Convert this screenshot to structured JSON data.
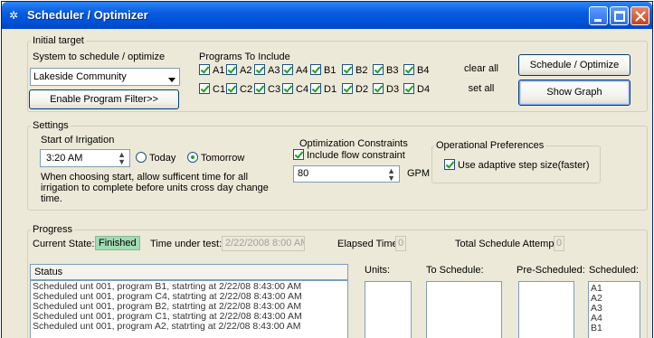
{
  "window": {
    "title": "Scheduler / Optimizer",
    "colors": {
      "titlebar": "#0054d9",
      "face": "#ece9d8",
      "finished": "#9fdbb3"
    }
  },
  "initial_target": {
    "group_title": "Initial target",
    "system_label": "System to schedule / optimize",
    "system_value": "Lakeside Community",
    "filter_button": "Enable Program Filter>>",
    "programs_label": "Programs To Include",
    "programs_row1": [
      "A1",
      "A2",
      "A3",
      "A4",
      "B1",
      "B2",
      "B3",
      "B4"
    ],
    "programs_row2": [
      "C1",
      "C2",
      "C3",
      "C4",
      "D1",
      "D2",
      "D3",
      "D4"
    ],
    "clear_all": "clear all",
    "set_all": "set all",
    "schedule_button": "Schedule / Optimize",
    "graph_button": "Show Graph"
  },
  "settings": {
    "group_title": "Settings",
    "start_label": "Start of Irrigation",
    "start_time": "3:20 AM",
    "today": "Today",
    "tomorrow": "Tomorrow",
    "note": "When choosing start, allow sufficent time for  all irrigation to complete before units cross day change time.",
    "constraints_label": "Optimization Constraints",
    "include_flow": "Include flow constraint",
    "flow_value": "80",
    "flow_unit": "GPM",
    "prefs_label": "Operational Preferences",
    "adaptive": "Use adaptive step size(faster)"
  },
  "progress": {
    "group_title": "Progress",
    "state_label": "Current State:",
    "state_value": "Finished",
    "time_label": "Time under test:",
    "time_value": "2/22/2008 8:00 AM",
    "elapsed_label": "Elapsed Time",
    "elapsed_value": "0",
    "attempts_label": "Total Schedule Attempts:",
    "attempts_value": "0"
  },
  "status": {
    "label": "Status",
    "lines": [
      "Scheduled unt 001, program B1, statrting at 2/22/08 8:43:00 AM",
      "Scheduled unt 001, program C4, statrting at 2/22/08 8:43:00 AM",
      "Scheduled unt 001, program B2, statrting at 2/22/08 8:43:00 AM",
      "Scheduled unt 001, program C1, statrting at 2/22/08 8:43:00 AM",
      "Scheduled unt 001, program A2, statrting at 2/22/08 8:43:00 AM"
    ]
  },
  "columns": {
    "units": "Units:",
    "to_schedule": "To Schedule:",
    "pre_scheduled": "Pre-Scheduled:",
    "scheduled": "Scheduled:",
    "scheduled_items": [
      "A1",
      "A2",
      "A3",
      "A4",
      "B1"
    ]
  }
}
